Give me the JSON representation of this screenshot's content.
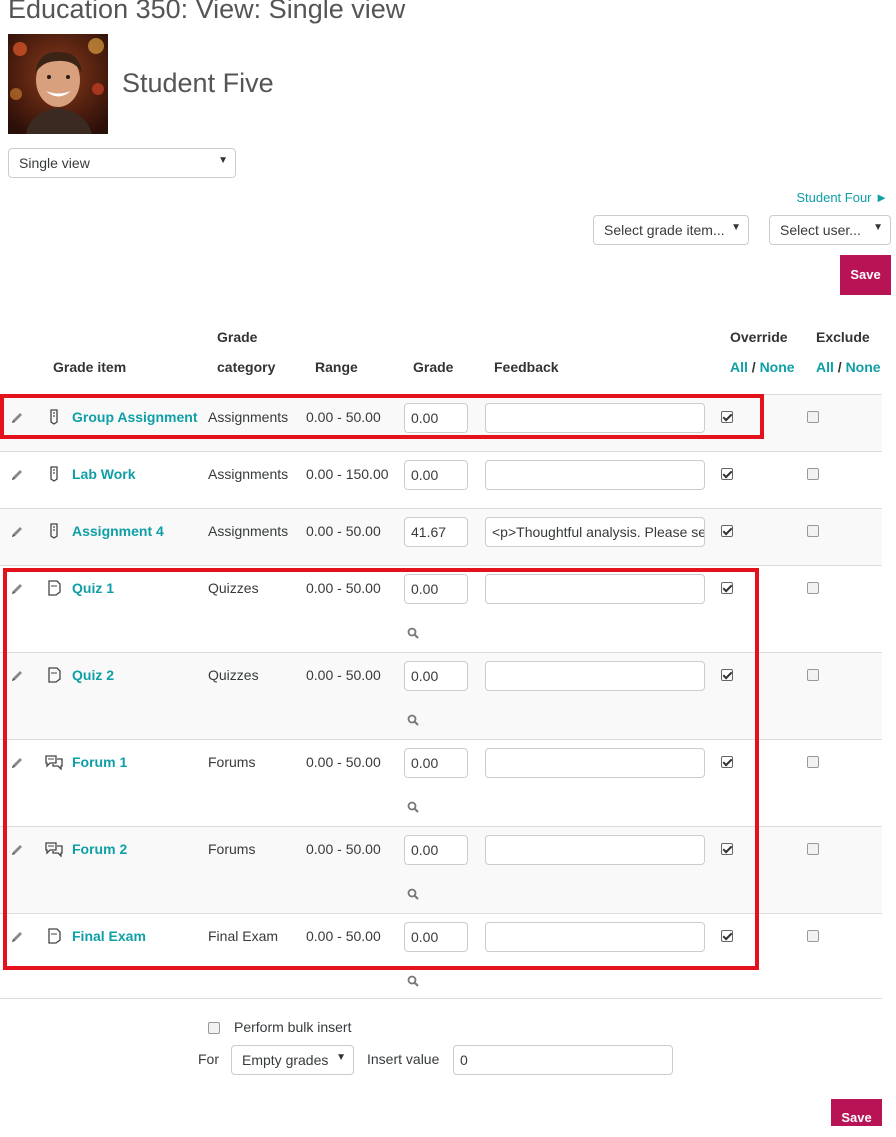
{
  "page": {
    "title": "Education 350: View: Single view",
    "student_name": "Student Five",
    "view_select": "Single view",
    "next_user_link": "Student Four ►",
    "grade_item_select": "Select grade item...",
    "user_select": "Select user...",
    "save_label": "Save"
  },
  "table": {
    "headers": {
      "grade_item": "Grade item",
      "grade_category_1": "Grade",
      "grade_category_2": "category",
      "range": "Range",
      "grade": "Grade",
      "feedback": "Feedback",
      "override": "Override",
      "exclude": "Exclude",
      "all": "All",
      "slash": "/",
      "none": "None"
    },
    "rows": [
      {
        "name": "Group Assignment",
        "icon": "assignment-icon",
        "category": "Assignments",
        "range": "0.00 - 50.00",
        "grade": "0.00",
        "feedback": "",
        "override": true,
        "exclude": false
      },
      {
        "name": "Lab Work",
        "icon": "assignment-icon",
        "category": "Assignments",
        "range": "0.00 - 150.00",
        "grade": "0.00",
        "feedback": "",
        "override": true,
        "exclude": false
      },
      {
        "name": "Assignment 4",
        "icon": "assignment-icon",
        "category": "Assignments",
        "range": "0.00 - 50.00",
        "grade": "41.67",
        "feedback": "<p>Thoughtful analysis. Please se",
        "override": true,
        "exclude": false
      },
      {
        "name": "Quiz 1",
        "icon": "quiz-icon",
        "category": "Quizzes",
        "range": "0.00 - 50.00",
        "grade": "0.00",
        "feedback": "",
        "override": true,
        "exclude": false
      },
      {
        "name": "Quiz 2",
        "icon": "quiz-icon",
        "category": "Quizzes",
        "range": "0.00 - 50.00",
        "grade": "0.00",
        "feedback": "",
        "override": true,
        "exclude": false
      },
      {
        "name": "Forum 1",
        "icon": "forum-icon",
        "category": "Forums",
        "range": "0.00 - 50.00",
        "grade": "0.00",
        "feedback": "",
        "override": true,
        "exclude": false
      },
      {
        "name": "Forum 2",
        "icon": "forum-icon",
        "category": "Forums",
        "range": "0.00 - 50.00",
        "grade": "0.00",
        "feedback": "",
        "override": true,
        "exclude": false
      },
      {
        "name": "Final Exam",
        "icon": "quiz-icon",
        "category": "Final Exam",
        "range": "0.00 - 50.00",
        "grade": "0.00",
        "feedback": "",
        "override": true,
        "exclude": false
      }
    ]
  },
  "bulk": {
    "label": "Perform bulk insert",
    "checked": false,
    "for_label": "For",
    "for_select": "Empty grades",
    "insert_label": "Insert value",
    "insert_value": "0"
  },
  "colors": {
    "accent": "#0f9fa7",
    "save": "#b81455",
    "highlight": "#e3121c"
  }
}
